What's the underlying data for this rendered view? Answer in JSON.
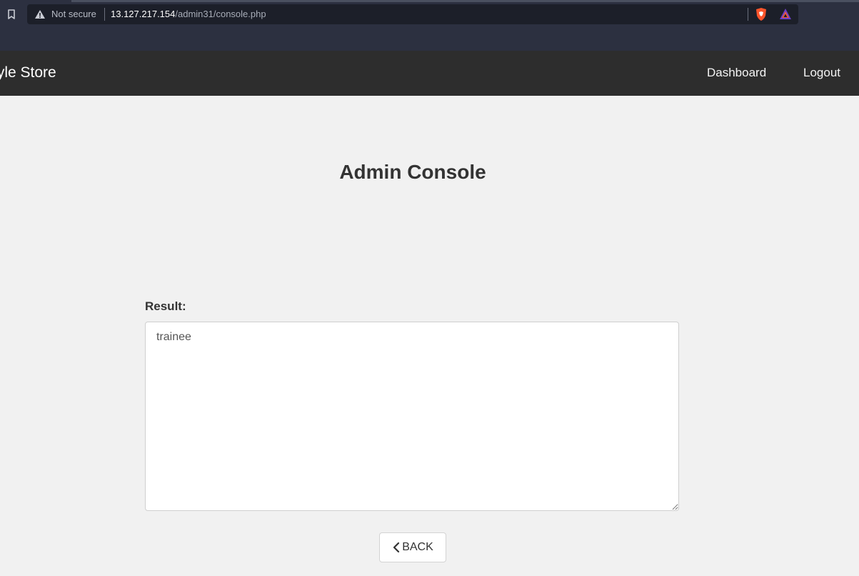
{
  "browser": {
    "security_label": "Not secure",
    "url_host": "13.127.217.154",
    "url_path": "/admin31/console.php",
    "icons": [
      "bookmark-icon",
      "warning-icon",
      "brave-shield-icon",
      "brave-rewards-icon"
    ]
  },
  "navbar": {
    "brand": "tyle Store",
    "links": [
      {
        "label": "Dashboard"
      },
      {
        "label": "Logout"
      }
    ]
  },
  "main": {
    "title": "Admin Console",
    "result_label": "Result:",
    "result_value": "trainee",
    "back_label": "BACK",
    "back_icon": "chevron-left-icon"
  },
  "colors": {
    "browser_bg": "#2c3040",
    "address_bar_bg": "#1c1f29",
    "navbar_bg": "#2d2d2d",
    "page_bg": "#f1f1f1",
    "text_dark": "#333333"
  }
}
